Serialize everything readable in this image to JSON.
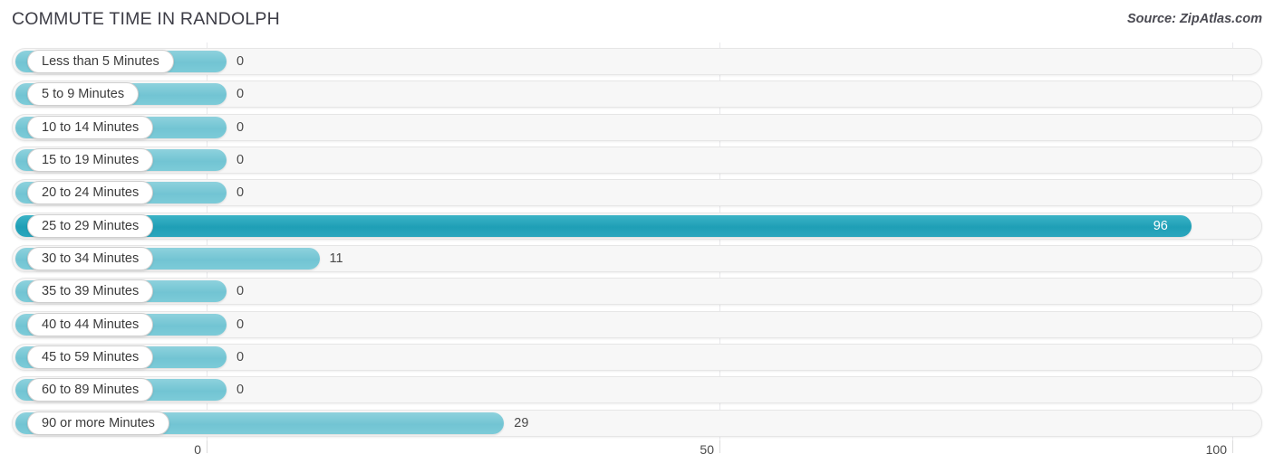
{
  "header": {
    "title": "COMMUTE TIME IN RANDOLPH",
    "source": "Source: ZipAtlas.com"
  },
  "colors": {
    "bar": "#7ccbd8",
    "bar_highlight": "#2ba6bd",
    "track": "#f7f7f7",
    "track_border": "#e6e6e6",
    "gridline": "#e9e9ec",
    "title_text": "#3d3d46",
    "label_text": "#3b3b3b",
    "value_text": "#4a4a4a",
    "value_text_inside": "#ffffff"
  },
  "chart_data": {
    "type": "bar",
    "orientation": "horizontal",
    "title": "COMMUTE TIME IN RANDOLPH",
    "subtitle": "Source: ZipAtlas.com",
    "xlabel": "",
    "ylabel": "",
    "xlim": [
      0,
      100
    ],
    "grid": true,
    "legend": null,
    "xticks": [
      0,
      50,
      100
    ],
    "xtick_labels": [
      "0",
      "50",
      "100"
    ],
    "highlight_index": 5,
    "categories": [
      "Less than 5 Minutes",
      "5 to 9 Minutes",
      "10 to 14 Minutes",
      "15 to 19 Minutes",
      "20 to 24 Minutes",
      "25 to 29 Minutes",
      "30 to 34 Minutes",
      "35 to 39 Minutes",
      "40 to 44 Minutes",
      "45 to 59 Minutes",
      "60 to 89 Minutes",
      "90 or more Minutes"
    ],
    "values": [
      0,
      0,
      0,
      0,
      0,
      96,
      11,
      0,
      0,
      0,
      0,
      29
    ],
    "value_labels": [
      "0",
      "0",
      "0",
      "0",
      "0",
      "96",
      "11",
      "0",
      "0",
      "0",
      "0",
      "29"
    ]
  },
  "rows": [
    {
      "label": "Less than 5 Minutes",
      "value": 0,
      "value_label": "0",
      "highlight": false
    },
    {
      "label": "5 to 9 Minutes",
      "value": 0,
      "value_label": "0",
      "highlight": false
    },
    {
      "label": "10 to 14 Minutes",
      "value": 0,
      "value_label": "0",
      "highlight": false
    },
    {
      "label": "15 to 19 Minutes",
      "value": 0,
      "value_label": "0",
      "highlight": false
    },
    {
      "label": "20 to 24 Minutes",
      "value": 0,
      "value_label": "0",
      "highlight": false
    },
    {
      "label": "25 to 29 Minutes",
      "value": 96,
      "value_label": "96",
      "highlight": true
    },
    {
      "label": "30 to 34 Minutes",
      "value": 11,
      "value_label": "11",
      "highlight": false
    },
    {
      "label": "35 to 39 Minutes",
      "value": 0,
      "value_label": "0",
      "highlight": false
    },
    {
      "label": "40 to 44 Minutes",
      "value": 0,
      "value_label": "0",
      "highlight": false
    },
    {
      "label": "45 to 59 Minutes",
      "value": 0,
      "value_label": "0",
      "highlight": false
    },
    {
      "label": "60 to 89 Minutes",
      "value": 0,
      "value_label": "0",
      "highlight": false
    },
    {
      "label": "90 or more Minutes",
      "value": 29,
      "value_label": "29",
      "highlight": false
    }
  ],
  "axis": {
    "ticks": [
      "0",
      "50",
      "100"
    ]
  }
}
